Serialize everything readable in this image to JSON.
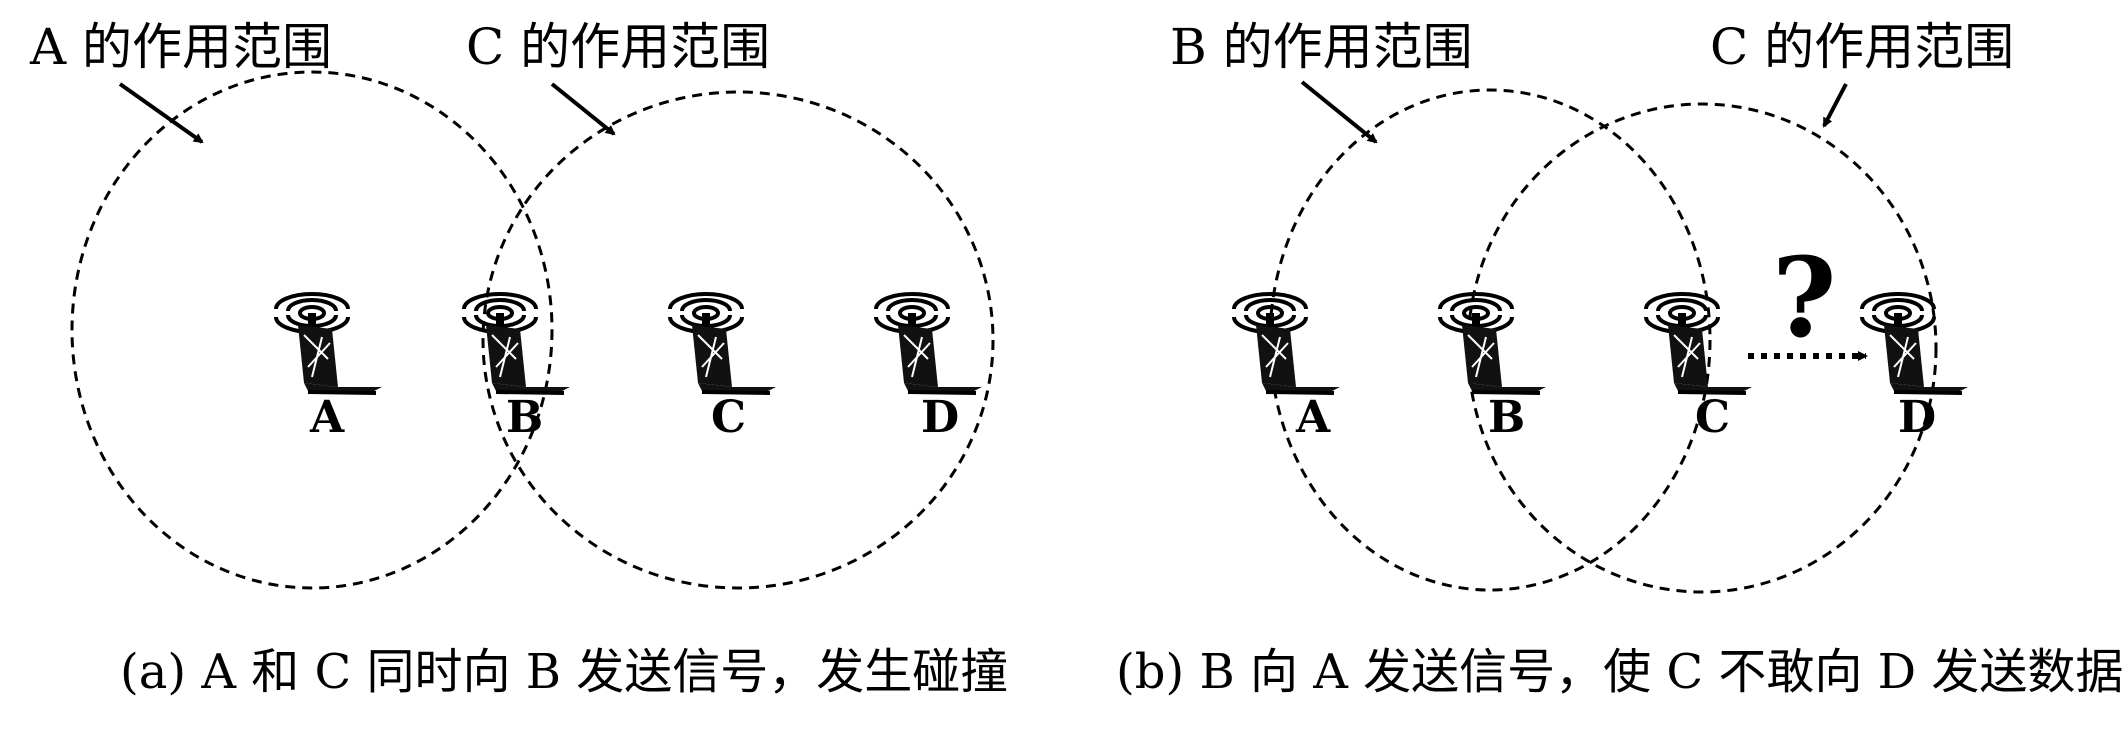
{
  "panel_a": {
    "range_label_a": "A 的作用范围",
    "range_label_c": "C 的作用范围",
    "nodes": [
      "A",
      "B",
      "C",
      "D"
    ],
    "caption": "(a) A 和 C 同时向 B 发送信号，发生碰撞"
  },
  "panel_b": {
    "range_label_b": "B 的作用范围",
    "range_label_c": "C 的作用范围",
    "nodes": [
      "A",
      "B",
      "C",
      "D"
    ],
    "question_mark": "?",
    "caption": "(b) B 向 A 发送信号，使 C 不敢向 D 发送数据"
  }
}
